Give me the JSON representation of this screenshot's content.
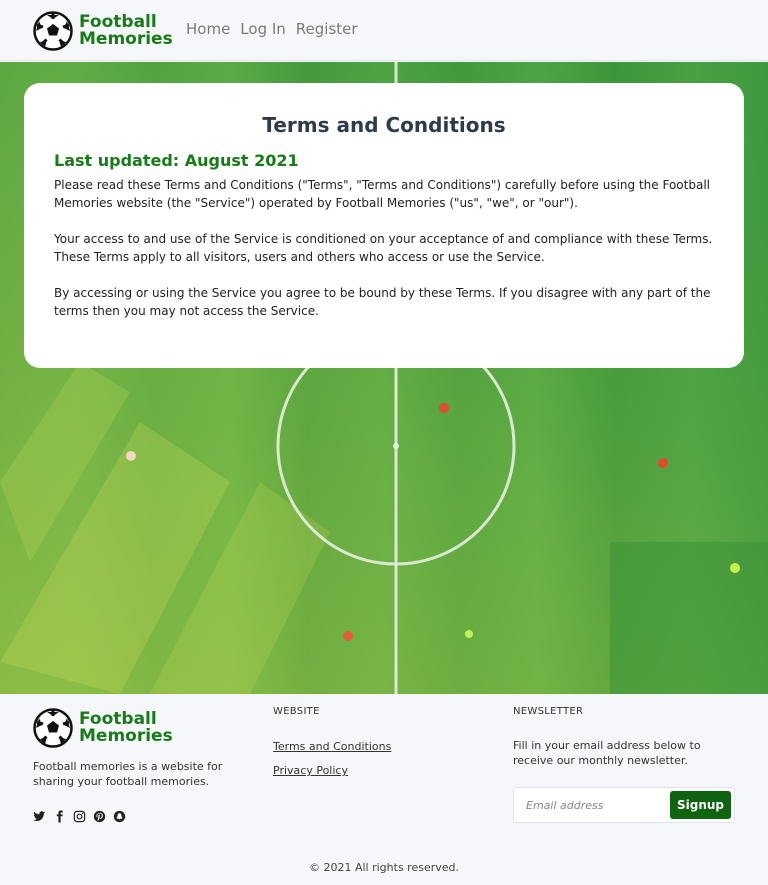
{
  "brand": {
    "line1": "Football",
    "line2": "Memories"
  },
  "nav": {
    "home": "Home",
    "login": "Log In",
    "register": "Register"
  },
  "card": {
    "title": "Terms and Conditions",
    "updated": "Last updated: August 2021",
    "paragraphs": [
      "Please read these Terms and Conditions (\"Terms\", \"Terms and Conditions\") carefully before using the Football Memories website (the \"Service\") operated by Football Memories (\"us\", \"we\", or \"our\").",
      "Your access to and use of the Service is conditioned on your acceptance of and compliance with these Terms. These Terms apply to all visitors, users and others who access or use the Service.",
      "By accessing or using the Service you agree to be bound by these Terms. If you disagree with any part of the terms then you may not access the Service."
    ]
  },
  "footer": {
    "description": "Football memories is a website for sharing your football memories.",
    "social_icons": [
      "twitter-icon",
      "facebook-icon",
      "instagram-icon",
      "pinterest-icon",
      "snapchat-icon"
    ],
    "website_heading": "WEBSITE",
    "links": {
      "terms": "Terms and Conditions",
      "privacy": "Privacy Policy"
    },
    "newsletter_heading": "NEWSLETTER",
    "newsletter_desc": "Fill in your email address below to receive our monthly newsletter.",
    "email_placeholder": "Email address",
    "signup_label": "Signup",
    "copyright": "© 2021 All rights reserved."
  },
  "colors": {
    "brand_green": "#177c17",
    "button_green": "#106310",
    "pitch_green": "#449f43"
  }
}
